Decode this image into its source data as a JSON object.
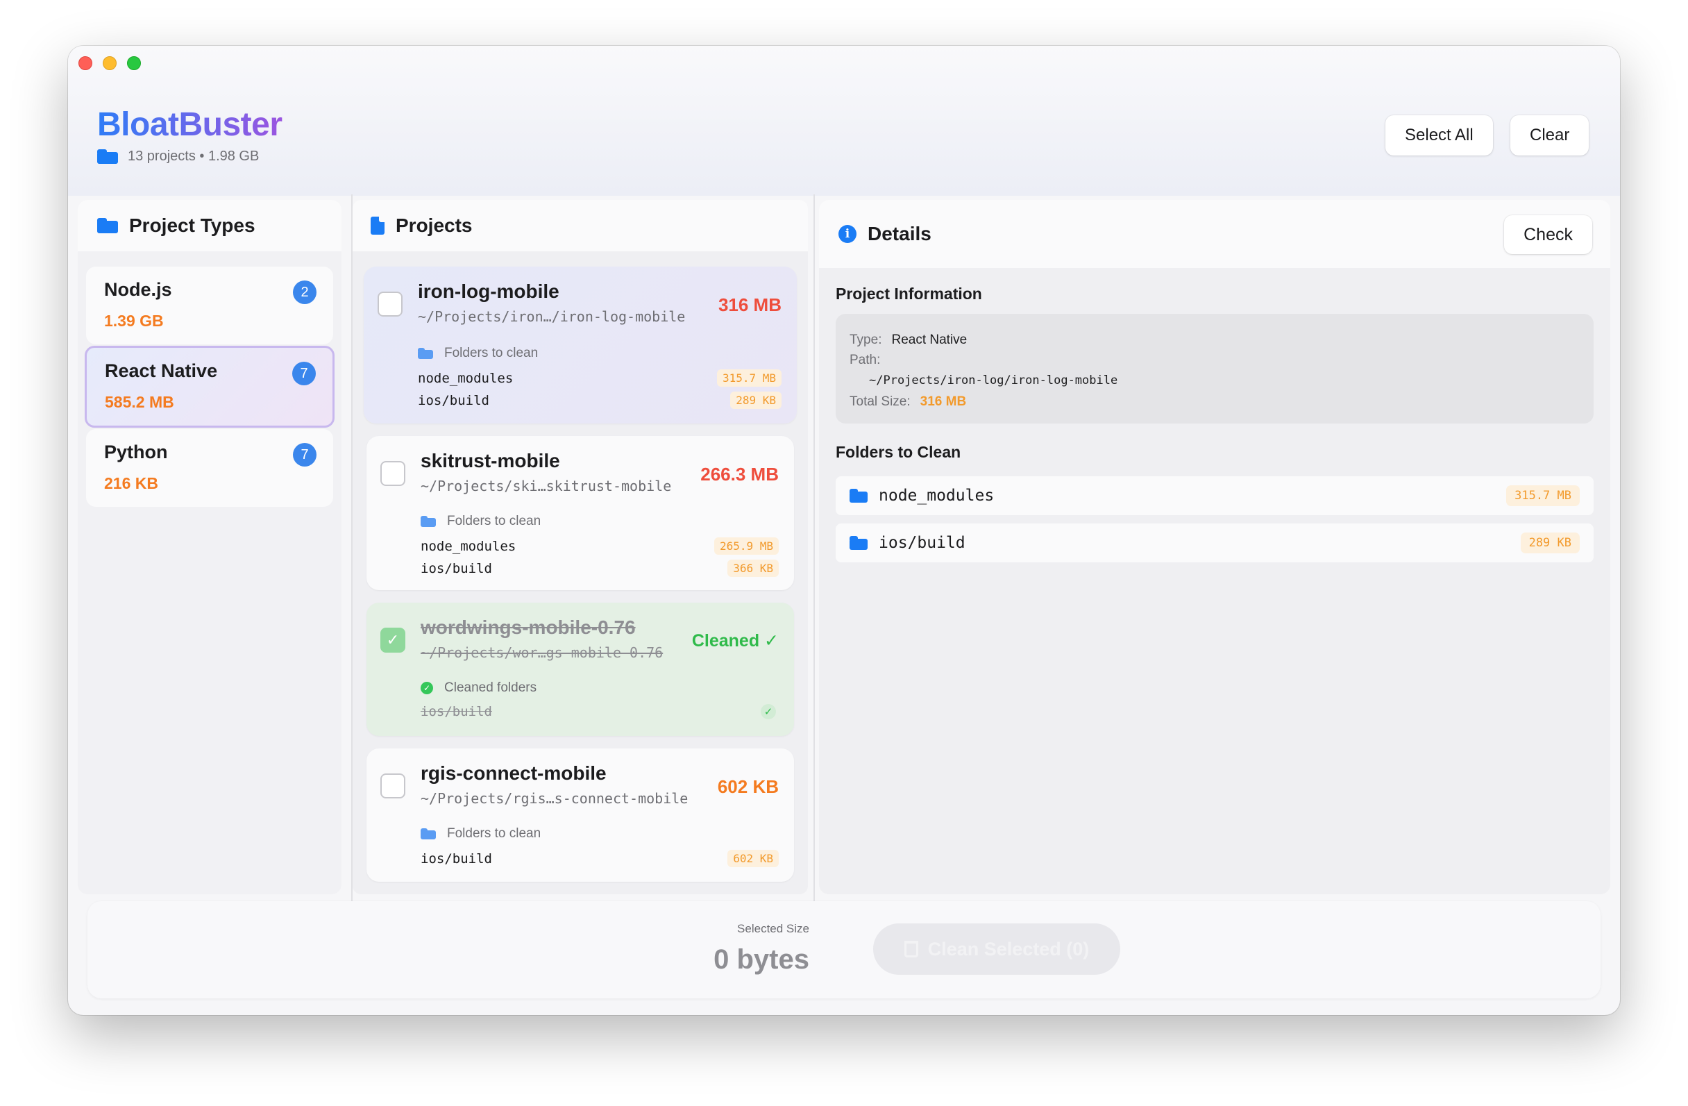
{
  "app": {
    "title": "BloatBuster",
    "subtitle": "13 projects • 1.98 GB"
  },
  "header": {
    "select_all_label": "Select All",
    "clear_label": "Clear"
  },
  "project_types": {
    "title": "Project Types",
    "items": [
      {
        "name": "Node.js",
        "size": "1.39 GB",
        "count": "2"
      },
      {
        "name": "React Native",
        "size": "585.2 MB",
        "count": "7"
      },
      {
        "name": "Python",
        "size": "216 KB",
        "count": "7"
      }
    ]
  },
  "projects": {
    "title": "Projects",
    "folders_to_clean_label": "Folders to clean",
    "cleaned_folders_label": "Cleaned folders",
    "items": [
      {
        "name": "iron-log-mobile",
        "path": "~/Projects/iron…/iron-log-mobile",
        "size": "316 MB",
        "folders": [
          {
            "name": "node_modules",
            "size": "315.7 MB"
          },
          {
            "name": "ios/build",
            "size": "289 KB"
          }
        ]
      },
      {
        "name": "skitrust-mobile",
        "path": "~/Projects/ski…skitrust-mobile",
        "size": "266.3 MB",
        "folders": [
          {
            "name": "node_modules",
            "size": "265.9 MB"
          },
          {
            "name": "ios/build",
            "size": "366 KB"
          }
        ]
      },
      {
        "name": "wordwings-mobile-0.76",
        "path": "~/Projects/wor…gs-mobile-0.76",
        "status": "Cleaned ✓",
        "folders": [
          {
            "name": "ios/build"
          }
        ]
      },
      {
        "name": "rgis-connect-mobile",
        "path": "~/Projects/rgis…s-connect-mobile",
        "size": "602 KB",
        "folders": [
          {
            "name": "ios/build",
            "size": "602 KB"
          }
        ]
      }
    ]
  },
  "details": {
    "title": "Details",
    "check_label": "Check",
    "info_title": "Project Information",
    "type_key": "Type:",
    "type_val": "React Native",
    "path_key": "Path:",
    "path_val": "~/Projects/iron-log/iron-log-mobile",
    "total_key": "Total Size:",
    "total_val": "316 MB",
    "folders_title": "Folders to Clean",
    "folders": [
      {
        "name": "node_modules",
        "size": "315.7 MB"
      },
      {
        "name": "ios/build",
        "size": "289 KB"
      }
    ]
  },
  "footer": {
    "selected_size_label": "Selected Size",
    "selected_size_value": "0 bytes",
    "clean_button_label": "Clean Selected (0)"
  },
  "colors": {
    "accent": "#1a7cf5",
    "size_orange": "#f47b20",
    "cleaned_green": "#2fba4a"
  }
}
